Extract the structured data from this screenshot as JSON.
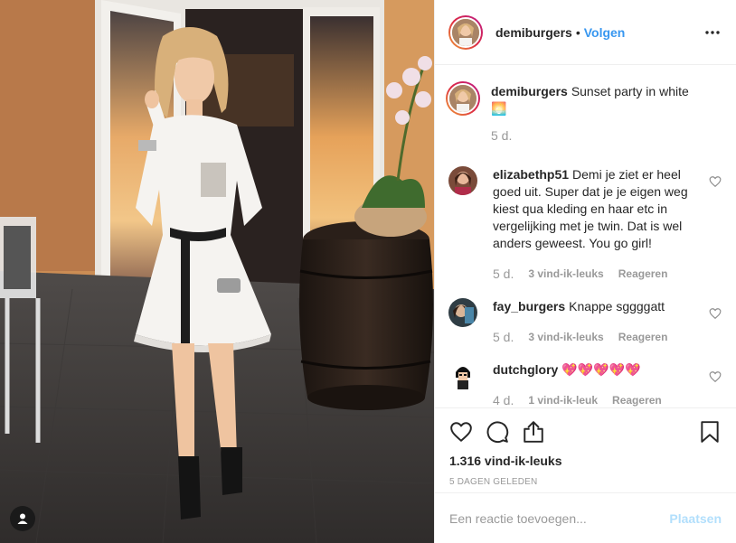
{
  "header": {
    "username": "demiburgers",
    "separator": "•",
    "follow_label": "Volgen",
    "more_icon": "more-horizontal-icon"
  },
  "caption": {
    "username": "demiburgers",
    "text": "Sunset party in white 🌅",
    "time": "5 d."
  },
  "comments": [
    {
      "username": "elizabethp51",
      "text": "Demi je ziet er heel goed uit. Super dat je je eigen weg kiest qua kleding en haar etc in vergelijking met je twin. Dat is wel anders geweest. You go girl!",
      "time": "5 d.",
      "likes": "3 vind-ik-leuks",
      "reply": "Reageren"
    },
    {
      "username": "fay_burgers",
      "text": "Knappe sggggatt",
      "time": "5 d.",
      "likes": "3 vind-ik-leuks",
      "reply": "Reageren"
    },
    {
      "username": "dutchglory",
      "text": "💖💖💖💖💖",
      "time": "4 d.",
      "likes": "1 vind-ik-leuk",
      "reply": "Reageren"
    }
  ],
  "actions": {
    "like_icon": "heart-icon",
    "comment_icon": "comment-icon",
    "share_icon": "share-icon",
    "save_icon": "bookmark-icon",
    "likes_total": "1.316 vind-ik-leuks",
    "post_date": "5 DAGEN GELEDEN"
  },
  "add_comment": {
    "placeholder": "Een reactie toevoegen...",
    "post_label": "Plaatsen"
  },
  "colors": {
    "accent": "#3897f0",
    "muted": "#999999",
    "border": "#efefef",
    "post_button_disabled": "#b2dffc"
  }
}
